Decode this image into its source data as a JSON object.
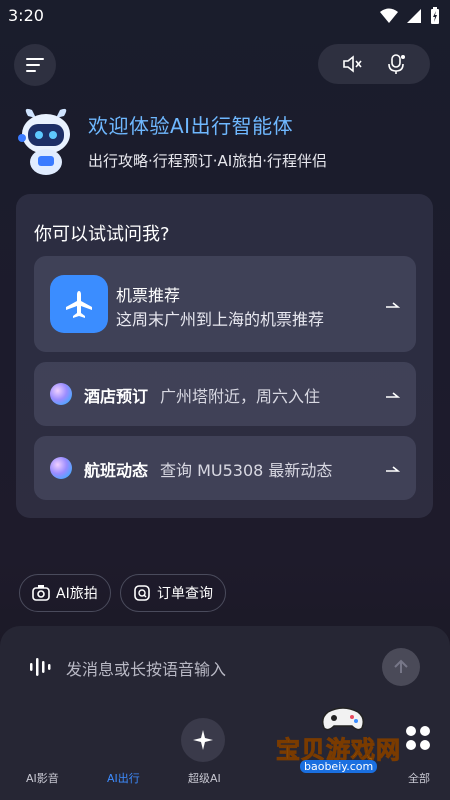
{
  "status_bar": {
    "time": "3:20"
  },
  "hero": {
    "title": "欢迎体验AI出行智能体",
    "subtitle": "出行攻略·行程预订·AI旅拍·行程伴侣"
  },
  "suggestions": {
    "heading": "你可以试试问我?",
    "featured": {
      "title": "机票推荐",
      "desc": "这周末广州到上海的机票推荐"
    },
    "items": [
      {
        "title": "酒店预订",
        "desc": "广州塔附近，周六入住"
      },
      {
        "title": "航班动态",
        "desc": "查询 MU5308 最新动态"
      }
    ]
  },
  "chips": [
    {
      "label": "AI旅拍",
      "icon": "camera-icon"
    },
    {
      "label": "订单查询",
      "icon": "order-search-icon"
    }
  ],
  "input": {
    "placeholder": "发消息或长按语音输入"
  },
  "bottom_nav": [
    {
      "label": "AI影音"
    },
    {
      "label": "AI出行",
      "active": true
    },
    {
      "label": "超级AI"
    },
    {
      "label": "全部"
    }
  ],
  "watermark": {
    "title": "宝贝游戏网",
    "url": "baobeiy.com"
  },
  "colors": {
    "accent": "#3d8cff",
    "hero_title": "#6fb8ff",
    "featured_icon_bg": "#3b8dff"
  }
}
